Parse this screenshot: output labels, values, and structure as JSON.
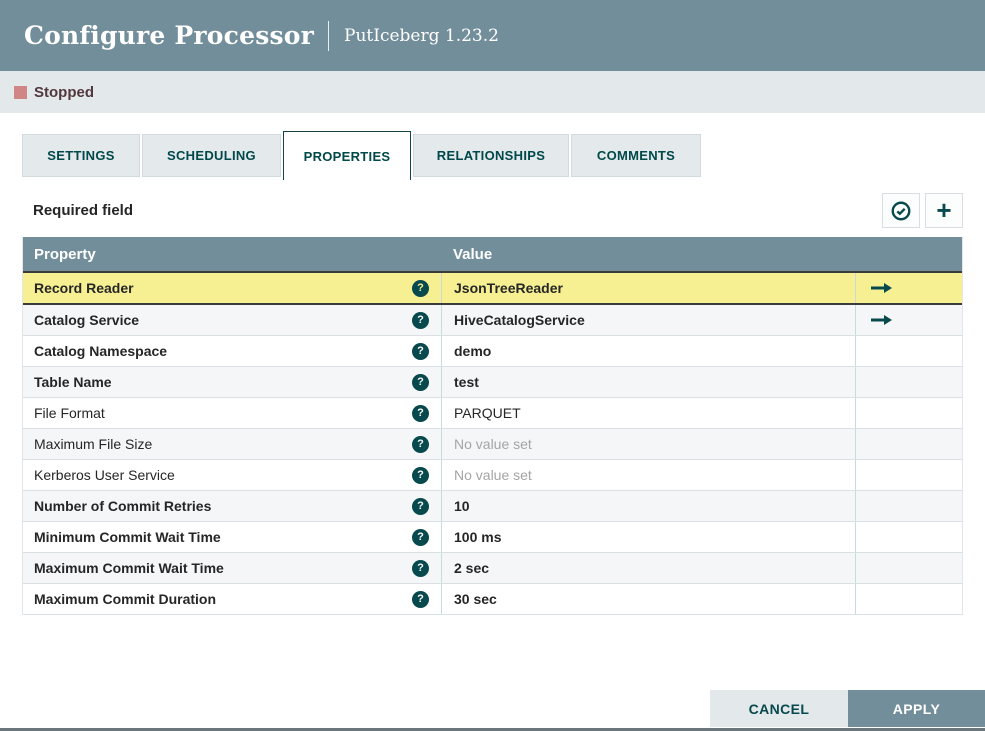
{
  "header": {
    "title": "Configure Processor",
    "subtitle": "PutIceberg 1.23.2"
  },
  "status_bar": {
    "state": "Stopped"
  },
  "tabs": [
    {
      "label": "SETTINGS",
      "active": false
    },
    {
      "label": "SCHEDULING",
      "active": false
    },
    {
      "label": "PROPERTIES",
      "active": true
    },
    {
      "label": "RELATIONSHIPS",
      "active": false
    },
    {
      "label": "COMMENTS",
      "active": false
    }
  ],
  "properties_toolbar": {
    "required_field_label": "Required field",
    "verify_icon": "check-circle",
    "add_icon": "plus"
  },
  "properties_table": {
    "columns": [
      "Property",
      "Value"
    ],
    "help_icon": "question-mark",
    "go_to_icon": "arrow-right",
    "rows": [
      {
        "property": "Record Reader",
        "value": "JsonTreeReader",
        "required": true,
        "selected": true,
        "value_set": true,
        "has_go_to_link": true
      },
      {
        "property": "Catalog Service",
        "value": "HiveCatalogService",
        "required": true,
        "selected": false,
        "value_set": true,
        "has_go_to_link": true
      },
      {
        "property": "Catalog Namespace",
        "value": "demo",
        "required": true,
        "selected": false,
        "value_set": true,
        "has_go_to_link": false
      },
      {
        "property": "Table Name",
        "value": "test",
        "required": true,
        "selected": false,
        "value_set": true,
        "has_go_to_link": false
      },
      {
        "property": "File Format",
        "value": "PARQUET",
        "required": false,
        "selected": false,
        "value_set": true,
        "has_go_to_link": false
      },
      {
        "property": "Maximum File Size",
        "value": "No value set",
        "required": false,
        "selected": false,
        "value_set": false,
        "has_go_to_link": false
      },
      {
        "property": "Kerberos User Service",
        "value": "No value set",
        "required": false,
        "selected": false,
        "value_set": false,
        "has_go_to_link": false
      },
      {
        "property": "Number of Commit Retries",
        "value": "10",
        "required": true,
        "selected": false,
        "value_set": true,
        "has_go_to_link": false
      },
      {
        "property": "Minimum Commit Wait Time",
        "value": "100 ms",
        "required": true,
        "selected": false,
        "value_set": true,
        "has_go_to_link": false
      },
      {
        "property": "Maximum Commit Wait Time",
        "value": "2 sec",
        "required": true,
        "selected": false,
        "value_set": true,
        "has_go_to_link": false
      },
      {
        "property": "Maximum Commit Duration",
        "value": "30 sec",
        "required": true,
        "selected": false,
        "value_set": true,
        "has_go_to_link": false
      }
    ]
  },
  "footer": {
    "cancel_label": "CANCEL",
    "apply_label": "APPLY"
  },
  "colors": {
    "header_bg": "#728e9b",
    "accent_teal": "#07494c",
    "selected_row_bg": "#f7f093",
    "stopped_indicator": "#d18686",
    "status_bar_bg": "#e3e8eb"
  }
}
